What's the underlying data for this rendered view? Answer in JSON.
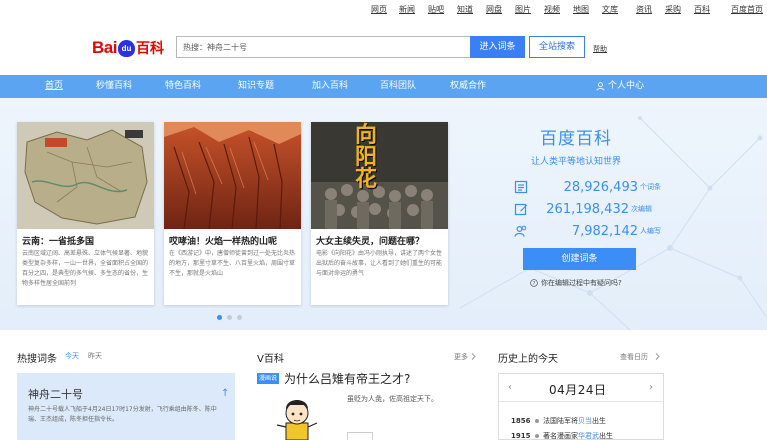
{
  "top_links": [
    "网页",
    "新闻",
    "贴吧",
    "知道",
    "网盘",
    "图片",
    "视频",
    "地图",
    "文库",
    "资讯",
    "采购",
    "百科",
    "百度首页"
  ],
  "logo": {
    "part1": "Bai",
    "paw": "du",
    "part2": "百科"
  },
  "search": {
    "placeholder": "热搜：神舟二十号",
    "enter_label": "进入词条",
    "all_label": "全站搜索",
    "help_label": "帮助"
  },
  "nav": {
    "items": [
      "首页",
      "秒懂百科",
      "特色百科",
      "知识专题",
      "加入百科",
      "百科团队",
      "权威合作"
    ],
    "user_center": "个人中心"
  },
  "carousel": {
    "cards": [
      {
        "title": "云南：一省抵多国",
        "desc": "云南区域辽阔、高差悬殊、立体气候显著、地貌类型复杂多样，一山一世界，全省面积占全国的百分之四，是典型的多气候、多生态的省份，生物多样性居全国前列"
      },
      {
        "title": "哎哮油！火焰一样热的山呢",
        "desc": "在《西游记》中，唐僧师徒曾到过一处无比炎热的地方，那里寸草不生、八百里火焰，周围寸草不生，那就是火焰山"
      },
      {
        "title": "大女主续失灵，问题在哪？",
        "desc": "电影《向阳花》由冯小刚执导，讲述了两个女性出狱后的奋斗故事，让人看到了她们重生的可能与面对命运的勇气"
      }
    ],
    "poster_text": "向阳花",
    "slides_total": 3,
    "slides_active": 1
  },
  "brand": {
    "title": "百度百科",
    "subtitle": "让人类平等地认知世界",
    "stats": [
      {
        "icon": "entry-icon",
        "value": "28,926,493",
        "unit": "个词条"
      },
      {
        "icon": "edit-icon",
        "value": "261,198,432",
        "unit": "次编辑"
      },
      {
        "icon": "users-icon",
        "value": "7,982,142",
        "unit": "人编写"
      }
    ],
    "create_label": "创建词条",
    "ask_label": "你在编辑过程中有疑问吗?"
  },
  "hot": {
    "title": "热搜词条",
    "tab_today": "今天",
    "tab_yesterday": "昨天",
    "card_title": "神舟二十号",
    "card_desc": "神舟二十号载人飞船于4月24日17时17分发射，飞行乘组由陈冬、陈中瑞、王杰组成，陈冬担任指令长。"
  },
  "vbaike": {
    "title": "V百科",
    "more": "更多",
    "badge": "漫画说",
    "video_title": "为什么吕雉有帝王之才?",
    "video_desc": "虽贬为人彘，佐高祖定天下。"
  },
  "history": {
    "title": "历史上的今天",
    "more": "查看日历",
    "date": "04月24日",
    "rows": [
      {
        "year": "1856",
        "prefix": "法国陆军将",
        "hl": "贝当",
        "suffix": "出生"
      },
      {
        "year": "1915",
        "prefix": "著名漫画家",
        "hl": "华君武",
        "suffix": "出生"
      }
    ]
  },
  "colors": {
    "accent": "#3a8ef5",
    "nav": "#5aa4f2",
    "logo_red": "#e10602",
    "logo_blue": "#2932e1"
  }
}
